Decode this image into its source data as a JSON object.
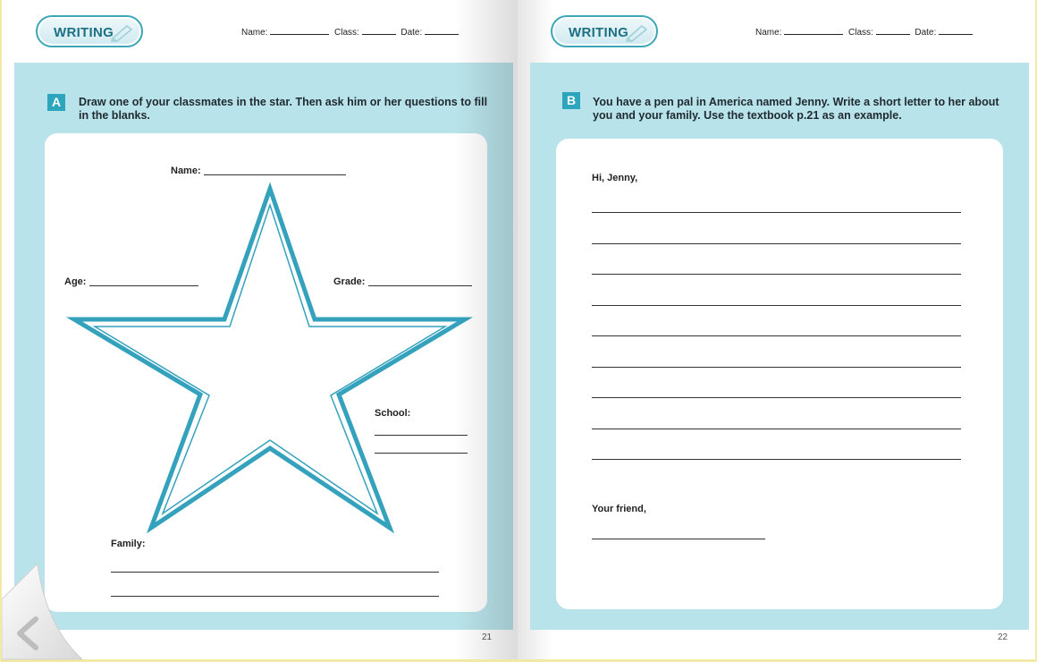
{
  "left_page": {
    "badge": "WRITING",
    "header": {
      "name_label": "Name:",
      "class_label": "Class:",
      "date_label": "Date:"
    },
    "section_letter": "A",
    "instruction": "Draw one of your classmates in the star. Then ask him or her questions to fill in the blanks.",
    "fields": {
      "name": "Name:",
      "age": "Age:",
      "grade": "Grade:",
      "school": "School:",
      "family": "Family:"
    },
    "page_number": "21"
  },
  "right_page": {
    "badge": "WRITING",
    "header": {
      "name_label": "Name:",
      "class_label": "Class:",
      "date_label": "Date:"
    },
    "section_letter": "B",
    "instruction": "You have a pen pal in America named Jenny. Write a short letter to her about you and your family. Use the textbook p.21 as an example.",
    "greeting": "Hi, Jenny,",
    "closing": "Your friend,",
    "page_number": "22"
  },
  "nav": {
    "prev_icon": "chevron-left-icon"
  },
  "colors": {
    "accent": "#2da5bd",
    "panel": "#b9e3ea",
    "star": "#35a2bd"
  }
}
